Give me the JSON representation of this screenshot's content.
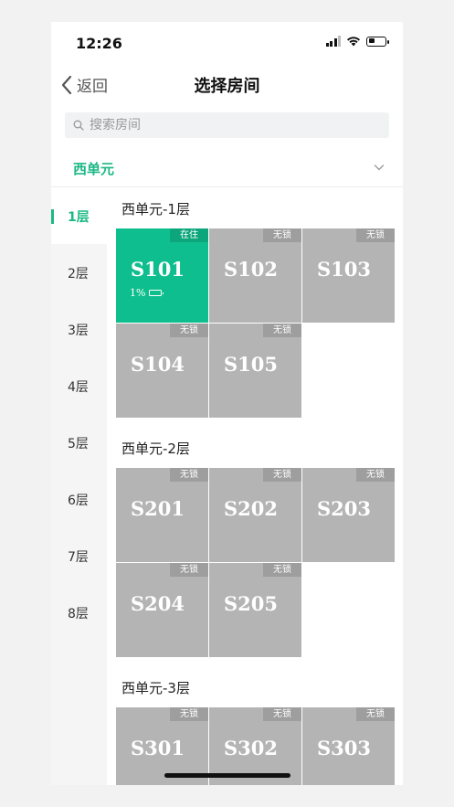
{
  "status_bar": {
    "time": "12:26"
  },
  "navbar": {
    "back_label": "返回",
    "title": "选择房间"
  },
  "search": {
    "placeholder": "搜索房间",
    "value": ""
  },
  "unit_selector": {
    "label": "西单元"
  },
  "colors": {
    "accent": "#1cb885",
    "occupied": "#0fbe8e",
    "vacant": "#b4b4b4"
  },
  "sidebar": {
    "floors": [
      "1层",
      "2层",
      "3层",
      "4层",
      "5层",
      "6层",
      "7层",
      "8层"
    ],
    "active_index": 0
  },
  "sections": [
    {
      "title": "西单元-1层",
      "rooms": [
        {
          "name": "S101",
          "status": "在住",
          "power": "1%"
        },
        {
          "name": "S102",
          "status": "无锁"
        },
        {
          "name": "S103",
          "status": "无锁"
        },
        {
          "name": "S104",
          "status": "无锁"
        },
        {
          "name": "S105",
          "status": "无锁"
        }
      ]
    },
    {
      "title": "西单元-2层",
      "rooms": [
        {
          "name": "S201",
          "status": "无锁"
        },
        {
          "name": "S202",
          "status": "无锁"
        },
        {
          "name": "S203",
          "status": "无锁"
        },
        {
          "name": "S204",
          "status": "无锁"
        },
        {
          "name": "S205",
          "status": "无锁"
        }
      ]
    },
    {
      "title": "西单元-3层",
      "rooms": [
        {
          "name": "S301",
          "status": "无锁"
        },
        {
          "name": "S302",
          "status": "无锁"
        },
        {
          "name": "S303",
          "status": "无锁"
        }
      ]
    }
  ]
}
